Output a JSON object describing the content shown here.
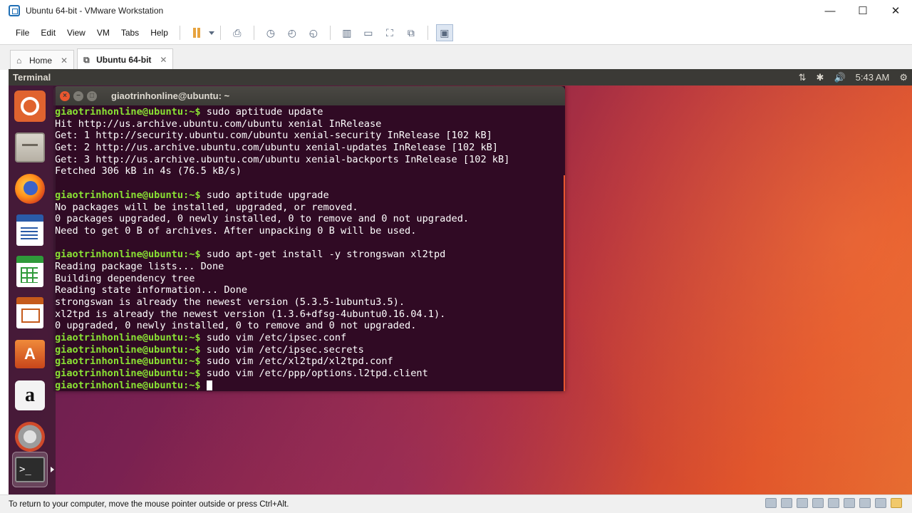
{
  "window": {
    "title": "Ubuntu 64-bit - VMware Workstation",
    "minimize": "—",
    "maximize": "☐",
    "close": "✕"
  },
  "menubar": {
    "items": [
      "File",
      "Edit",
      "View",
      "VM",
      "Tabs",
      "Help"
    ]
  },
  "toolbar": {
    "icons": [
      "pause-icon",
      "send-ctrl-alt-del-icon",
      "snapshot-icon",
      "revert-snapshot-icon",
      "snapshot-manager-icon",
      "library-icon",
      "fullscreen-icon",
      "unity-icon",
      "stretch-icon",
      "console-view-icon"
    ]
  },
  "tabs": [
    {
      "label": "Home",
      "icon": "home-icon",
      "close": "✕"
    },
    {
      "label": "Ubuntu 64-bit",
      "icon": "vm-icon",
      "close": "✕"
    }
  ],
  "ubuntu_panel": {
    "app_name": "Terminal",
    "indicators": [
      "⇅",
      "✱",
      "🔊"
    ],
    "clock": "5:43 AM",
    "gear": "⚙"
  },
  "launcher": {
    "items": [
      "Search your computer",
      "Files",
      "Firefox Web Browser",
      "LibreOffice Writer",
      "LibreOffice Calc",
      "LibreOffice Impress",
      "Ubuntu Software",
      "Amazon",
      "System Settings",
      "Terminal"
    ],
    "software_glyph": "A",
    "amazon_glyph": "a",
    "terminal_glyph": ">_"
  },
  "terminal": {
    "title": "giaotrinhonline@ubuntu: ~",
    "prompt": "giaotrinhonline@ubuntu:~$",
    "lines": [
      {
        "prompt": true,
        "text": " sudo aptitude update"
      },
      {
        "prompt": false,
        "text": "Hit http://us.archive.ubuntu.com/ubuntu xenial InRelease"
      },
      {
        "prompt": false,
        "text": "Get: 1 http://security.ubuntu.com/ubuntu xenial-security InRelease [102 kB]"
      },
      {
        "prompt": false,
        "text": "Get: 2 http://us.archive.ubuntu.com/ubuntu xenial-updates InRelease [102 kB]"
      },
      {
        "prompt": false,
        "text": "Get: 3 http://us.archive.ubuntu.com/ubuntu xenial-backports InRelease [102 kB]"
      },
      {
        "prompt": false,
        "text": "Fetched 306 kB in 4s (76.5 kB/s)"
      },
      {
        "prompt": false,
        "text": ""
      },
      {
        "prompt": true,
        "text": " sudo aptitude upgrade"
      },
      {
        "prompt": false,
        "text": "No packages will be installed, upgraded, or removed."
      },
      {
        "prompt": false,
        "text": "0 packages upgraded, 0 newly installed, 0 to remove and 0 not upgraded."
      },
      {
        "prompt": false,
        "text": "Need to get 0 B of archives. After unpacking 0 B will be used."
      },
      {
        "prompt": false,
        "text": ""
      },
      {
        "prompt": true,
        "text": " sudo apt-get install -y strongswan xl2tpd"
      },
      {
        "prompt": false,
        "text": "Reading package lists... Done"
      },
      {
        "prompt": false,
        "text": "Building dependency tree"
      },
      {
        "prompt": false,
        "text": "Reading state information... Done"
      },
      {
        "prompt": false,
        "text": "strongswan is already the newest version (5.3.5-1ubuntu3.5)."
      },
      {
        "prompt": false,
        "text": "xl2tpd is already the newest version (1.3.6+dfsg-4ubuntu0.16.04.1)."
      },
      {
        "prompt": false,
        "text": "0 upgraded, 0 newly installed, 0 to remove and 0 not upgraded."
      },
      {
        "prompt": true,
        "text": " sudo vim /etc/ipsec.conf"
      },
      {
        "prompt": true,
        "text": " sudo vim /etc/ipsec.secrets"
      },
      {
        "prompt": true,
        "text": " sudo vim /etc/xl2tpd/xl2tpd.conf"
      },
      {
        "prompt": true,
        "text": " sudo vim /etc/ppp/options.l2tpd.client"
      },
      {
        "prompt": true,
        "text": " ",
        "cursor": true
      }
    ]
  },
  "statusbar": {
    "hint": "To return to your computer, move the mouse pointer outside or press Ctrl+Alt."
  },
  "colors": {
    "prompt_green": "#8ae234",
    "terminal_bg": "#300a24",
    "ubuntu_orange": "#e9572f"
  }
}
